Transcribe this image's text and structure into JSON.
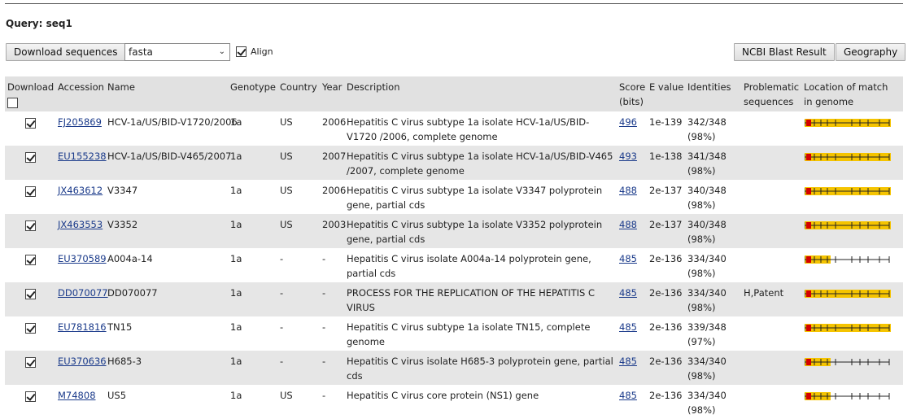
{
  "query_label": "Query: seq1",
  "toolbar": {
    "download_label": "Download sequences",
    "format_value": "fasta",
    "align_label": "Align",
    "ncbi_label": "NCBI Blast Result",
    "geography_label": "Geography"
  },
  "table": {
    "headers": {
      "download": "Download",
      "accession": "Accession",
      "name": "Name",
      "genotype": "Genotype",
      "country": "Country",
      "year": "Year",
      "description": "Description",
      "score": "Score (bits)",
      "evalue": "E value",
      "identities": "Identities",
      "problematic": "Problematic sequences",
      "location": "Location of match in genome"
    },
    "rows": [
      {
        "accession": "FJ205869",
        "name": "HCV-1a/US/BID-V1720/2006",
        "genotype": "1a",
        "country": "US",
        "year": "2006",
        "description": "Hepatitis C virus subtype 1a isolate HCV-1a/US/BID-V1720 /2006, complete genome",
        "score": "496",
        "evalue": "1e-139",
        "identities": "342/348 (98%)",
        "problematic": "",
        "coverage": "full"
      },
      {
        "accession": "EU155238",
        "name": "HCV-1a/US/BID-V465/2007",
        "genotype": "1a",
        "country": "US",
        "year": "2007",
        "description": "Hepatitis C virus subtype 1a isolate HCV-1a/US/BID-V465 /2007, complete genome",
        "score": "493",
        "evalue": "1e-138",
        "identities": "341/348 (98%)",
        "problematic": "",
        "coverage": "full"
      },
      {
        "accession": "JX463612",
        "name": "V3347",
        "genotype": "1a",
        "country": "US",
        "year": "2006",
        "description": "Hepatitis C virus subtype 1a isolate V3347 polyprotein gene, partial cds",
        "score": "488",
        "evalue": "2e-137",
        "identities": "340/348 (98%)",
        "problematic": "",
        "coverage": "full"
      },
      {
        "accession": "JX463553",
        "name": "V3352",
        "genotype": "1a",
        "country": "US",
        "year": "2003",
        "description": "Hepatitis C virus subtype 1a isolate V3352 polyprotein gene, partial cds",
        "score": "488",
        "evalue": "2e-137",
        "identities": "340/348 (98%)",
        "problematic": "",
        "coverage": "full"
      },
      {
        "accession": "EU370589",
        "name": "A004a-14",
        "genotype": "1a",
        "country": "-",
        "year": "-",
        "description": "Hepatitis C virus isolate A004a-14 polyprotein gene, partial cds",
        "score": "485",
        "evalue": "2e-136",
        "identities": "334/340 (98%)",
        "problematic": "",
        "coverage": "partial"
      },
      {
        "accession": "DD070077",
        "name": "DD070077",
        "genotype": "1a",
        "country": "-",
        "year": "-",
        "description": "PROCESS FOR THE REPLICATION OF THE HEPATITIS C VIRUS",
        "score": "485",
        "evalue": "2e-136",
        "identities": "334/340 (98%)",
        "problematic": "H,Patent",
        "coverage": "full"
      },
      {
        "accession": "EU781816",
        "name": "TN15",
        "genotype": "1a",
        "country": "-",
        "year": "-",
        "description": "Hepatitis C virus subtype 1a isolate TN15, complete genome",
        "score": "485",
        "evalue": "2e-136",
        "identities": "339/348 (97%)",
        "problematic": "",
        "coverage": "full"
      },
      {
        "accession": "EU370636",
        "name": "H685-3",
        "genotype": "1a",
        "country": "-",
        "year": "-",
        "description": "Hepatitis C virus isolate H685-3 polyprotein gene, partial cds",
        "score": "485",
        "evalue": "2e-136",
        "identities": "334/340 (98%)",
        "problematic": "",
        "coverage": "partial"
      },
      {
        "accession": "M74808",
        "name": "US5",
        "genotype": "1a",
        "country": "US",
        "year": "-",
        "description": "Hepatitis C virus core protein (NS1) gene",
        "score": "485",
        "evalue": "2e-136",
        "identities": "334/340 (98%)",
        "problematic": "",
        "coverage": "partial"
      }
    ]
  },
  "colors": {
    "match_bar": "#f5c400",
    "hit_marker": "#d40000",
    "link": "#1a3a8a",
    "header_bg": "#e1e1e1",
    "alt_row_bg": "#e6e6e6"
  }
}
